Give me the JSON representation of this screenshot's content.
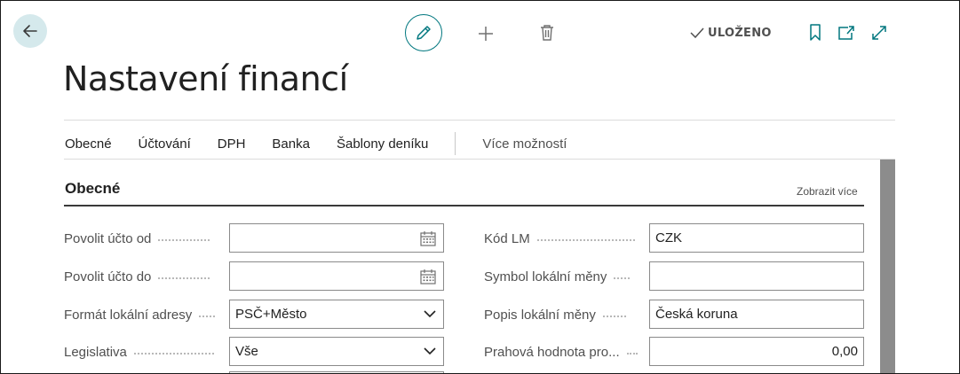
{
  "header": {
    "title": "Nastavení financí",
    "saved_label": "ULOŽENO"
  },
  "tabs": {
    "items": [
      "Obecné",
      "Účtování",
      "DPH",
      "Banka",
      "Šablony deníku"
    ],
    "more": "Více možností"
  },
  "section": {
    "title": "Obecné",
    "show_more": "Zobrazit více"
  },
  "fields_left": [
    {
      "label": "Povolit účto od",
      "value": "",
      "type": "date"
    },
    {
      "label": "Povolit účto do",
      "value": "",
      "type": "date"
    },
    {
      "label": "Formát lokální adresy",
      "value": "PSČ+Město",
      "type": "select"
    },
    {
      "label": "Legislativa",
      "value": "Vše",
      "type": "select"
    }
  ],
  "fields_right": [
    {
      "label": "Kód LM",
      "value": "CZK",
      "type": "text"
    },
    {
      "label": "Symbol lokální měny",
      "value": "",
      "type": "text"
    },
    {
      "label": "Popis lokální měny",
      "value": "Česká koruna",
      "type": "text"
    },
    {
      "label": "Prahová hodnota pro...",
      "value": "0,00",
      "type": "number"
    }
  ],
  "icons": {
    "back": "back-arrow-icon",
    "edit": "pencil-icon",
    "new": "plus-icon",
    "delete": "trash-icon",
    "saved": "checkmark-icon",
    "bookmark": "bookmark-icon",
    "open_new": "open-in-new-window-icon",
    "expand": "expand-icon",
    "calendar": "calendar-icon",
    "dropdown": "chevron-down-icon"
  },
  "colors": {
    "accent": "#00777f",
    "back_bg": "#d5e9ec",
    "scrollbar": "#8c8c8c"
  }
}
